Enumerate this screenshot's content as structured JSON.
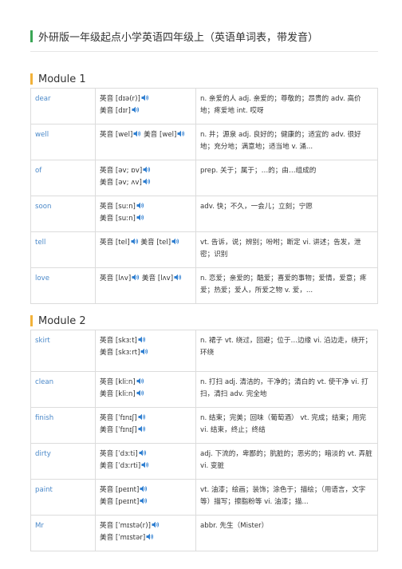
{
  "page_title": "外研版一年级起点小学英语四年级上（英语单词表，带发音）",
  "colors": {
    "title_accent": "#3aa655",
    "section_accent": "#f2b23a",
    "word_text": "#4a88c9",
    "speaker_icon": "#2f7fd1"
  },
  "sections": [
    {
      "title": "Module 1",
      "rows": [
        {
          "word": "dear",
          "pron": [
            [
              "英音 [dɪə(r)]"
            ],
            [
              "美音 [dɪr]"
            ]
          ],
          "meaning": "n. 亲爱的人 adj. 亲爱的；尊敬的；昂贵的 adv. 高价地；疼爱地 int. 哎呀"
        },
        {
          "word": "well",
          "pron": [
            [
              "英音 [wel]",
              "美音 [wel]"
            ]
          ],
          "meaning": "n. 井；源泉 adj. 良好的；健康的；适宜的 adv. 很好地；充分地；满意地；适当地 v. 涌..."
        },
        {
          "word": "of",
          "pron": [
            [
              "英音 [əv; ɒv]"
            ],
            [
              "美音 [əv; ʌv]"
            ]
          ],
          "meaning": "prep. 关于；属于；…的；由…组成的"
        },
        {
          "word": "soon",
          "pron": [
            [
              "英音 [suːn]"
            ],
            [
              "美音 [suːn]"
            ]
          ],
          "meaning": "adv. 快；不久，一会儿；立刻；宁愿"
        },
        {
          "word": "tell",
          "pron": [
            [
              "英音 [tel]",
              "美音 [tel]"
            ]
          ],
          "meaning": "vt. 告诉，说；辨别；吩咐；断定 vi. 讲述；告发，泄密；识别"
        },
        {
          "word": "love",
          "pron": [
            [
              "英音 [lʌv]",
              "美音 [lʌv]"
            ]
          ],
          "meaning": "n. 恋爱；亲爱的；酷爱；喜爱的事物；爱情，爱意；疼爱；热爱；爱人，所爱之物 v. 爱，..."
        }
      ]
    },
    {
      "title": "Module 2",
      "rows": [
        {
          "word": "skirt",
          "pron": [
            [
              "英音 [skɜːt]"
            ],
            [
              "美音 [skɜːrt]"
            ]
          ],
          "meaning": "n. 裙子 vt. 绕过，回避；位于…边缘 vi. 沿边走，绕开；环绕"
        },
        {
          "word": "clean",
          "pron": [
            [
              "英音 [kliːn]"
            ],
            [
              "美音 [kliːn]"
            ]
          ],
          "meaning": "n. 打扫 adj. 清洁的，干净的；清白的 vt. 使干净 vi. 打扫，清扫 adv. 完全地"
        },
        {
          "word": "finish",
          "pron": [
            [
              "英音 [ˈfɪnɪʃ]"
            ],
            [
              "美音 [ˈfɪnɪʃ]"
            ]
          ],
          "meaning": "n. 结束；完美；回味（葡萄酒） vt. 完成；结束；用完 vi. 结束，终止；终结"
        },
        {
          "word": "dirty",
          "pron": [
            [
              "英音 [ˈdɜːti]"
            ],
            [
              "美音 [ˈdɜːrti]"
            ]
          ],
          "meaning": "adj. 下流的，卑鄙的；肮脏的；恶劣的；暗淡的 vt. 弄脏 vi. 变脏"
        },
        {
          "word": "paint",
          "pron": [
            [
              "英音 [peɪnt]"
            ],
            [
              "美音 [peɪnt]"
            ]
          ],
          "meaning": "vt. 油漆；绘画；装饰；涂色于；描绘；（用语言，文字等）描写；擦脂粉等 vi. 油漆；描..."
        },
        {
          "word": "Mr",
          "pron": [
            [
              "英音 [ˈmɪstə(r)]"
            ],
            [
              "美音 [ˈmɪstər]"
            ]
          ],
          "meaning": "abbr. 先生（Mister）"
        }
      ]
    }
  ]
}
